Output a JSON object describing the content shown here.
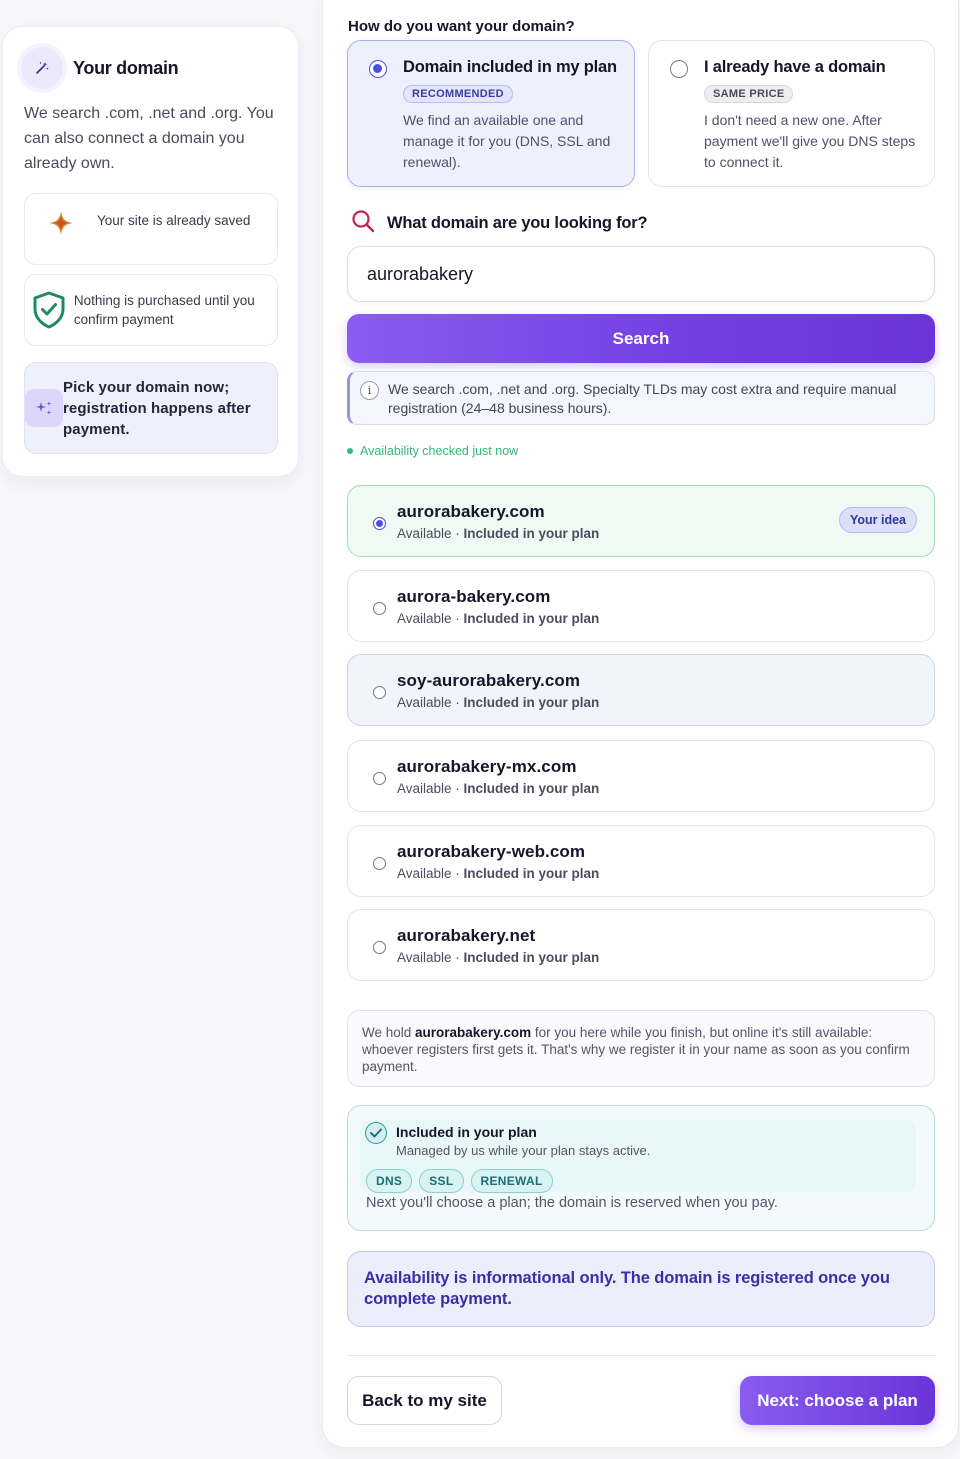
{
  "sidebar": {
    "title": "Your domain",
    "description": "We search .com, .net and .org. You can also connect a domain you already own.",
    "items": [
      {
        "icon": "sparkle-icon",
        "text": "Your site is already saved"
      },
      {
        "icon": "shield-check-icon",
        "text": "Nothing is purchased until you confirm payment"
      },
      {
        "icon": "stars-icon",
        "text": "Pick your domain now; registration happens after payment."
      }
    ]
  },
  "main": {
    "question": "How do you want your domain?",
    "options": [
      {
        "title": "Domain included in my plan",
        "badge": "RECOMMENDED",
        "description": "We find an available one and manage it for you (DNS, SSL and renewal).",
        "selected": true
      },
      {
        "title": "I already have a domain",
        "badge": "SAME PRICE",
        "description": "I don't need a new one. After payment we'll give you DNS steps to connect it.",
        "selected": false
      }
    ],
    "search": {
      "label": "What domain are you looking for?",
      "value": "aurorabakery",
      "button": "Search",
      "note": "We search .com, .net and .org. Specialty TLDs may cost extra and require manual registration (24–48 business hours).",
      "availability": "Availability checked just now"
    },
    "results": [
      {
        "name": "aurorabakery.com",
        "status": "Available",
        "sep": " · ",
        "plan": "Included in your plan",
        "badge": "Your idea",
        "selected": true
      },
      {
        "name": "aurora-bakery.com",
        "status": "Available",
        "sep": " · ",
        "plan": "Included in your plan",
        "selected": false
      },
      {
        "name": "soy-aurorabakery.com",
        "status": "Available",
        "sep": " · ",
        "plan": "Included in your plan",
        "selected": false
      },
      {
        "name": "aurorabakery-mx.com",
        "status": "Available",
        "sep": " · ",
        "plan": "Included in your plan",
        "selected": false
      },
      {
        "name": "aurorabakery-web.com",
        "status": "Available",
        "sep": " · ",
        "plan": "Included in your plan",
        "selected": false
      },
      {
        "name": "aurorabakery.net",
        "status": "Available",
        "sep": " · ",
        "plan": "Included in your plan",
        "selected": false
      }
    ],
    "hold": {
      "prefix": "We hold ",
      "domain": "aurorabakery.com",
      "suffix": " for you here while you finish, but online it's still available: whoever registers first gets it. That's why we register it in your name as soon as you confirm payment."
    },
    "plan": {
      "title": "Included in your plan",
      "subtitle": "Managed by us while your plan stays active.",
      "tags": [
        "DNS",
        "SSL",
        "RENEWAL"
      ],
      "next": "Next you'll choose a plan; the domain is reserved when you pay."
    },
    "warning": "Availability is informational only. The domain is registered once you complete payment.",
    "back_button": "Back to my site",
    "next_button": "Next: choose a plan"
  },
  "colors": {
    "accent": "#7440e4",
    "selected_radio": "#4a4fe0",
    "available_green": "#36b87a",
    "plan_teal": "#2a9aa0",
    "warning_text": "#3a2fa8"
  }
}
